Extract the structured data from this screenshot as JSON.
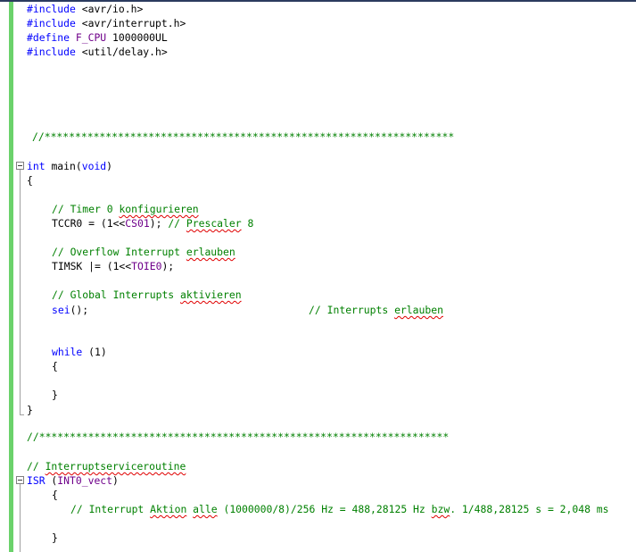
{
  "editor": {
    "lines": {
      "inc1": {
        "kw": "#include",
        "rest": " <avr/io.h>"
      },
      "inc2": {
        "kw": "#include",
        "rest": " <avr/interrupt.h>"
      },
      "def": {
        "kw": "#define",
        "sp": " ",
        "macro": "F_CPU",
        "rest": " 1000000UL"
      },
      "inc3": {
        "kw": "#include",
        "rest": " <util/delay.h>"
      },
      "sep1": "//*******************************************************************",
      "main_sig": {
        "kw": "int",
        "sp": " ",
        "name": "main",
        "open": "(",
        "kw2": "void",
        "close": ")"
      },
      "brace_open_main": "{",
      "cm_timer": {
        "a": "// Timer 0 ",
        "b": "konfigurieren"
      },
      "tccr0": {
        "a": "TCCR0 = (1<<",
        "macro": "CS01",
        "b": "); ",
        "c": "// ",
        "d": "Prescaler",
        "e": " 8"
      },
      "cm_overflow": {
        "a": "// Overflow Interrupt ",
        "b": "erlauben"
      },
      "timsk": {
        "a": "TIMSK |= (1<<",
        "macro": "TOIE0",
        "b": ");"
      },
      "cm_global": {
        "a": "// Global Interrupts ",
        "b": "aktivieren"
      },
      "sei": {
        "kw": "sei",
        "rest": "();",
        "pad": "                                    ",
        "c": "// Interrupts ",
        "d": "erlauben"
      },
      "while": {
        "kw": "while",
        "rest": " (1)"
      },
      "brace_open_while": "{",
      "brace_close_while": "}",
      "brace_close_main": "}",
      "sep2": "//*******************************************************************",
      "cm_isr": {
        "a": "// ",
        "b": "Interruptserviceroutine"
      },
      "isr_sig": {
        "kw": "ISR",
        "rest": " (",
        "macro": "INT0_vect",
        "close": ")"
      },
      "brace_open_isr": "{",
      "cm_action": {
        "a": "// Interrupt ",
        "b": "Aktion",
        "c": " ",
        "d": "alle",
        "e": " (1000000/8)/256 Hz = 488,28125 Hz ",
        "f": "bzw",
        "g": ". 1/488,28125 s = 2,048 ms"
      },
      "brace_close_isr": "}"
    }
  },
  "colors": {
    "keyword": "#0000ff",
    "comment": "#008000",
    "macro": "#6f008a",
    "change_bar": "#6bd26b"
  }
}
